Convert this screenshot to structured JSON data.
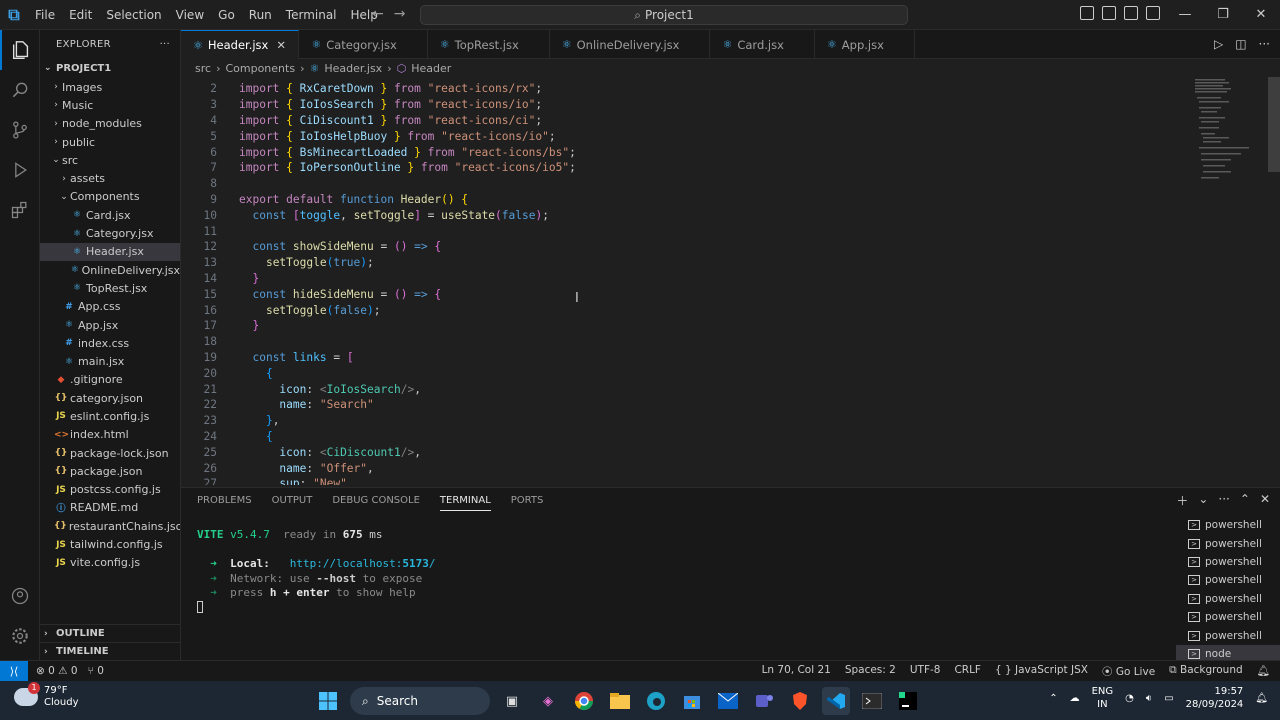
{
  "titlebar": {
    "menu": [
      "File",
      "Edit",
      "Selection",
      "View",
      "Go",
      "Run",
      "Terminal",
      "Help"
    ],
    "search_text": "Project1",
    "nav_back": "←",
    "nav_forward": "→"
  },
  "sidebar": {
    "title": "EXPLORER",
    "project": "PROJECT1",
    "outline": "OUTLINE",
    "timeline": "TIMELINE",
    "items": [
      {
        "label": "Images",
        "depth": 1,
        "type": "folder",
        "open": false
      },
      {
        "label": "Music",
        "depth": 1,
        "type": "folder",
        "open": false
      },
      {
        "label": "node_modules",
        "depth": 1,
        "type": "folder",
        "open": false
      },
      {
        "label": "public",
        "depth": 1,
        "type": "folder",
        "open": false
      },
      {
        "label": "src",
        "depth": 1,
        "type": "folder",
        "open": true
      },
      {
        "label": "assets",
        "depth": 2,
        "type": "folder",
        "open": false
      },
      {
        "label": "Components",
        "depth": 2,
        "type": "folder",
        "open": true
      },
      {
        "label": "Card.jsx",
        "depth": 3,
        "type": "jsx"
      },
      {
        "label": "Category.jsx",
        "depth": 3,
        "type": "jsx"
      },
      {
        "label": "Header.jsx",
        "depth": 3,
        "type": "jsx",
        "selected": true
      },
      {
        "label": "OnlineDelivery.jsx",
        "depth": 3,
        "type": "jsx"
      },
      {
        "label": "TopRest.jsx",
        "depth": 3,
        "type": "jsx"
      },
      {
        "label": "App.css",
        "depth": 2,
        "type": "css"
      },
      {
        "label": "App.jsx",
        "depth": 2,
        "type": "jsx"
      },
      {
        "label": "index.css",
        "depth": 2,
        "type": "css"
      },
      {
        "label": "main.jsx",
        "depth": 2,
        "type": "jsx"
      },
      {
        "label": ".gitignore",
        "depth": 1,
        "type": "git"
      },
      {
        "label": "category.json",
        "depth": 1,
        "type": "json"
      },
      {
        "label": "eslint.config.js",
        "depth": 1,
        "type": "js"
      },
      {
        "label": "index.html",
        "depth": 1,
        "type": "html"
      },
      {
        "label": "package-lock.json",
        "depth": 1,
        "type": "json"
      },
      {
        "label": "package.json",
        "depth": 1,
        "type": "json"
      },
      {
        "label": "postcss.config.js",
        "depth": 1,
        "type": "js"
      },
      {
        "label": "README.md",
        "depth": 1,
        "type": "md"
      },
      {
        "label": "restaurantChains.json",
        "depth": 1,
        "type": "json"
      },
      {
        "label": "tailwind.config.js",
        "depth": 1,
        "type": "js"
      },
      {
        "label": "vite.config.js",
        "depth": 1,
        "type": "js"
      }
    ]
  },
  "tabs": [
    {
      "label": "Header.jsx",
      "active": true
    },
    {
      "label": "Category.jsx"
    },
    {
      "label": "TopRest.jsx"
    },
    {
      "label": "OnlineDelivery.jsx"
    },
    {
      "label": "Card.jsx"
    },
    {
      "label": "App.jsx"
    }
  ],
  "breadcrumb": [
    "src",
    "Components",
    "Header.jsx",
    "Header"
  ],
  "code_lines": [
    {
      "n": "2",
      "tokens": [
        [
          "kw",
          "import "
        ],
        [
          "br1",
          "{ "
        ],
        [
          "var",
          "RxCaretDown"
        ],
        [
          "br1",
          " } "
        ],
        [
          "kw",
          "from "
        ],
        [
          "str",
          "\"react-icons/rx\""
        ],
        [
          "p",
          ";"
        ]
      ]
    },
    {
      "n": "3",
      "tokens": [
        [
          "kw",
          "import "
        ],
        [
          "br1",
          "{ "
        ],
        [
          "var",
          "IoIosSearch"
        ],
        [
          "br1",
          " } "
        ],
        [
          "kw",
          "from "
        ],
        [
          "str",
          "\"react-icons/io\""
        ],
        [
          "p",
          ";"
        ]
      ]
    },
    {
      "n": "4",
      "tokens": [
        [
          "kw",
          "import "
        ],
        [
          "br1",
          "{ "
        ],
        [
          "var",
          "CiDiscount1"
        ],
        [
          "br1",
          " } "
        ],
        [
          "kw",
          "from "
        ],
        [
          "str",
          "\"react-icons/ci\""
        ],
        [
          "p",
          ";"
        ]
      ]
    },
    {
      "n": "5",
      "tokens": [
        [
          "kw",
          "import "
        ],
        [
          "br1",
          "{ "
        ],
        [
          "var",
          "IoIosHelpBuoy"
        ],
        [
          "br1",
          " } "
        ],
        [
          "kw",
          "from "
        ],
        [
          "str",
          "\"react-icons/io\""
        ],
        [
          "p",
          ";"
        ]
      ]
    },
    {
      "n": "6",
      "tokens": [
        [
          "kw",
          "import "
        ],
        [
          "br1",
          "{ "
        ],
        [
          "var",
          "BsMinecartLoaded"
        ],
        [
          "br1",
          " } "
        ],
        [
          "kw",
          "from "
        ],
        [
          "str",
          "\"react-icons/bs\""
        ],
        [
          "p",
          ";"
        ]
      ]
    },
    {
      "n": "7",
      "tokens": [
        [
          "kw",
          "import "
        ],
        [
          "br1",
          "{ "
        ],
        [
          "var",
          "IoPersonOutline"
        ],
        [
          "br1",
          " } "
        ],
        [
          "kw",
          "from "
        ],
        [
          "str",
          "\"react-icons/io5\""
        ],
        [
          "p",
          ";"
        ]
      ]
    },
    {
      "n": "8",
      "tokens": []
    },
    {
      "n": "9",
      "tokens": [
        [
          "kw",
          "export default "
        ],
        [
          "kw2",
          "function "
        ],
        [
          "fn",
          "Header"
        ],
        [
          "br1",
          "() {"
        ]
      ]
    },
    {
      "n": "10",
      "tokens": [
        [
          "p",
          "  "
        ],
        [
          "kw2",
          "const "
        ],
        [
          "br2",
          "["
        ],
        [
          "cst",
          "toggle"
        ],
        [
          "p",
          ", "
        ],
        [
          "fn",
          "setToggle"
        ],
        [
          "br2",
          "]"
        ],
        [
          "p",
          " = "
        ],
        [
          "fn",
          "useState"
        ],
        [
          "br2",
          "("
        ],
        [
          "kw2",
          "false"
        ],
        [
          "br2",
          ")"
        ],
        [
          "p",
          ";"
        ]
      ]
    },
    {
      "n": "11",
      "tokens": []
    },
    {
      "n": "12",
      "tokens": [
        [
          "p",
          "  "
        ],
        [
          "kw2",
          "const "
        ],
        [
          "fn",
          "showSideMenu"
        ],
        [
          "p",
          " = "
        ],
        [
          "br2",
          "() "
        ],
        [
          "kw2",
          "=> "
        ],
        [
          "br2",
          "{"
        ]
      ]
    },
    {
      "n": "13",
      "tokens": [
        [
          "p",
          "    "
        ],
        [
          "fn",
          "setToggle"
        ],
        [
          "br3",
          "("
        ],
        [
          "kw2",
          "true"
        ],
        [
          "br3",
          ")"
        ],
        [
          "p",
          ";"
        ]
      ]
    },
    {
      "n": "14",
      "tokens": [
        [
          "p",
          "  "
        ],
        [
          "br2",
          "}"
        ]
      ]
    },
    {
      "n": "15",
      "tokens": [
        [
          "p",
          "  "
        ],
        [
          "kw2",
          "const "
        ],
        [
          "fn",
          "hideSideMenu"
        ],
        [
          "p",
          " = "
        ],
        [
          "br2",
          "() "
        ],
        [
          "kw2",
          "=> "
        ],
        [
          "br2",
          "{"
        ]
      ]
    },
    {
      "n": "16",
      "tokens": [
        [
          "p",
          "    "
        ],
        [
          "fn",
          "setToggle"
        ],
        [
          "br3",
          "("
        ],
        [
          "kw2",
          "false"
        ],
        [
          "br3",
          ")"
        ],
        [
          "p",
          ";"
        ]
      ]
    },
    {
      "n": "17",
      "tokens": [
        [
          "p",
          "  "
        ],
        [
          "br2",
          "}"
        ]
      ]
    },
    {
      "n": "18",
      "tokens": []
    },
    {
      "n": "19",
      "tokens": [
        [
          "p",
          "  "
        ],
        [
          "kw2",
          "const "
        ],
        [
          "cst",
          "links"
        ],
        [
          "p",
          " = "
        ],
        [
          "br2",
          "["
        ]
      ]
    },
    {
      "n": "20",
      "tokens": [
        [
          "p",
          "    "
        ],
        [
          "br3",
          "{"
        ]
      ]
    },
    {
      "n": "21",
      "tokens": [
        [
          "p",
          "      "
        ],
        [
          "var",
          "icon"
        ],
        [
          "p",
          ": "
        ],
        [
          "tagp",
          "<"
        ],
        [
          "jsx",
          "IoIosSearch"
        ],
        [
          "tagp",
          "/>"
        ],
        [
          "p",
          ","
        ]
      ]
    },
    {
      "n": "22",
      "tokens": [
        [
          "p",
          "      "
        ],
        [
          "var",
          "name"
        ],
        [
          "p",
          ": "
        ],
        [
          "str",
          "\"Search\""
        ]
      ]
    },
    {
      "n": "23",
      "tokens": [
        [
          "p",
          "    "
        ],
        [
          "br3",
          "}"
        ],
        [
          "p",
          ","
        ]
      ]
    },
    {
      "n": "24",
      "tokens": [
        [
          "p",
          "    "
        ],
        [
          "br3",
          "{"
        ]
      ]
    },
    {
      "n": "25",
      "tokens": [
        [
          "p",
          "      "
        ],
        [
          "var",
          "icon"
        ],
        [
          "p",
          ": "
        ],
        [
          "tagp",
          "<"
        ],
        [
          "jsx",
          "CiDiscount1"
        ],
        [
          "tagp",
          "/>"
        ],
        [
          "p",
          ","
        ]
      ]
    },
    {
      "n": "26",
      "tokens": [
        [
          "p",
          "      "
        ],
        [
          "var",
          "name"
        ],
        [
          "p",
          ": "
        ],
        [
          "str",
          "\"Offer\""
        ],
        [
          "p",
          ","
        ]
      ]
    },
    {
      "n": "27",
      "tokens": [
        [
          "p",
          "      "
        ],
        [
          "var",
          "sup"
        ],
        [
          "p",
          ": "
        ],
        [
          "str",
          "\"New\""
        ]
      ]
    }
  ],
  "panel": {
    "tabs": [
      "PROBLEMS",
      "OUTPUT",
      "DEBUG CONSOLE",
      "TERMINAL",
      "PORTS"
    ],
    "active_tab": "TERMINAL",
    "terminal": {
      "vite": "VITE",
      "version": "v5.4.7",
      "ready": "ready in",
      "ms": "675",
      "ms_unit": "ms",
      "local_label": "Local:",
      "local_url_prefix": "http://localhost:",
      "local_port": "5173",
      "local_url_suffix": "/",
      "network_label": "Network",
      "network_text": ": use ",
      "network_flag": "--host",
      "network_end": " to expose",
      "help_pre": "press ",
      "help_key": "h + enter",
      "help_post": " to show help",
      "arrow": "➜"
    },
    "terminals": [
      "powershell",
      "powershell",
      "powershell",
      "powershell",
      "powershell",
      "powershell",
      "powershell",
      "node"
    ]
  },
  "statusbar": {
    "errors": "0",
    "warnings": "0",
    "ports": "0",
    "position": "Ln 70, Col 21",
    "spaces": "Spaces: 2",
    "encoding": "UTF-8",
    "eol": "CRLF",
    "language": "JavaScript JSX",
    "golive": "Go Live",
    "background": "Background"
  },
  "taskbar": {
    "temp": "79°F",
    "condition": "Cloudy",
    "badge": "1",
    "search": "Search",
    "lang1": "ENG",
    "lang2": "IN",
    "time": "19:57",
    "date": "28/09/2024"
  }
}
